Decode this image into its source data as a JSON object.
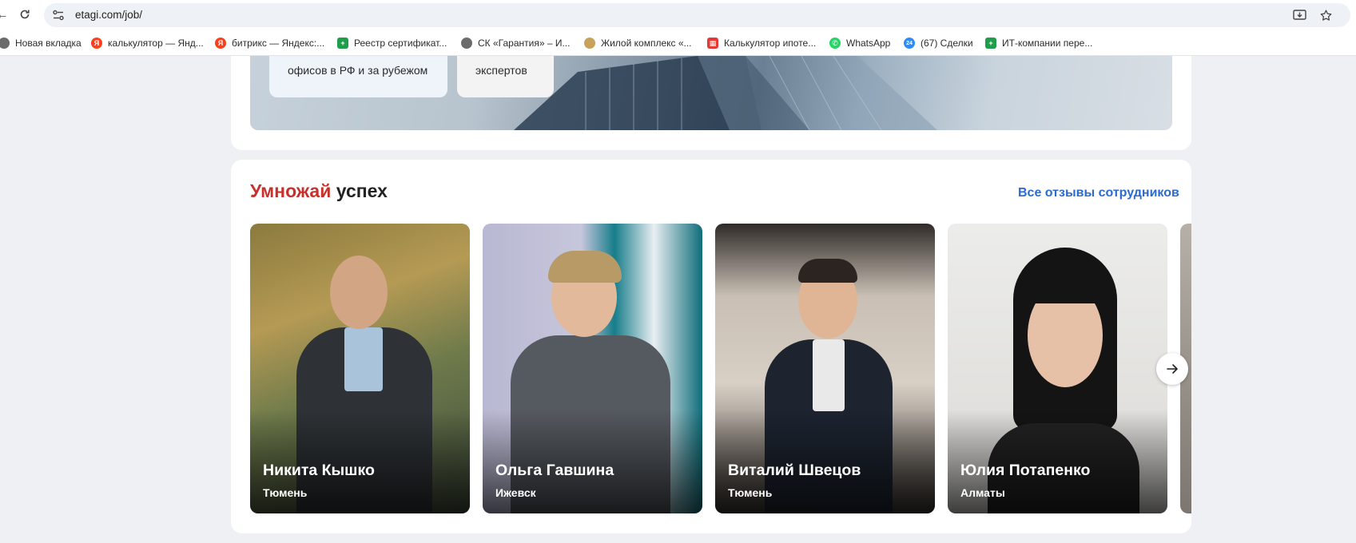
{
  "browser": {
    "url": "etagi.com/job/",
    "bookmarks": [
      {
        "label": "Новая вкладка",
        "icon": "globe-icon",
        "color": "#555555"
      },
      {
        "label": "калькулятор — Янд...",
        "icon": "yandex-icon",
        "color": "#fc3f1d"
      },
      {
        "label": "битрикс — Яндекс:...",
        "icon": "yandex-icon",
        "color": "#fc3f1d"
      },
      {
        "label": "Реестр сертификат...",
        "icon": "sheets-icon",
        "color": "#1e9e4a"
      },
      {
        "label": "СК «Гарантия» – И...",
        "icon": "globe-icon",
        "color": "#555555"
      },
      {
        "label": "Жилой комплекс «...",
        "icon": "complex-icon",
        "color": "#c8a15a"
      },
      {
        "label": "Калькулятор ипоте...",
        "icon": "calculator-icon",
        "color": "#e53935"
      },
      {
        "label": "WhatsApp",
        "icon": "whatsapp-icon",
        "color": "#25d366"
      },
      {
        "label": "(67) Сделки",
        "icon": "bitrix24-icon",
        "color": "#2fc6f6"
      },
      {
        "label": "ИТ-компании пере...",
        "icon": "sheets-icon",
        "color": "#1e9e4a"
      }
    ]
  },
  "banner": {
    "stat_1": "офисов в РФ и за рубежом",
    "stat_2": "экспертов"
  },
  "section": {
    "title_accent": "Умножай",
    "title_rest": "успех",
    "all_reviews": "Все отзывы сотрудников",
    "accent_color": "#c9302c",
    "link_color": "#2a6bd1"
  },
  "people": [
    {
      "name": "Никита Кышко",
      "city": "Тюмень"
    },
    {
      "name": "Ольга Гавшина",
      "city": "Ижевск"
    },
    {
      "name": "Виталий Швецов",
      "city": "Тюмень"
    },
    {
      "name": "Юлия Потапенко",
      "city": "Алматы"
    }
  ]
}
